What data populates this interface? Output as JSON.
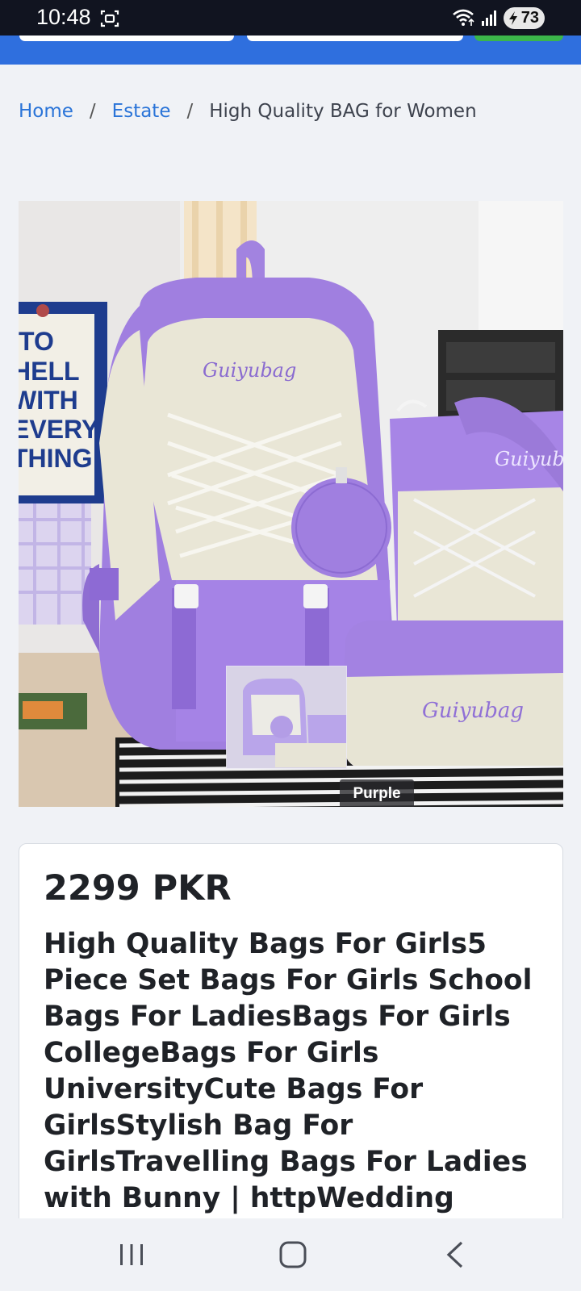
{
  "status_bar": {
    "time": "10:48",
    "battery": "73",
    "icons": [
      "screenshot-icon",
      "wifi-icon",
      "signal-icon",
      "battery-icon"
    ]
  },
  "breadcrumb": {
    "home": "Home",
    "category": "Estate",
    "current": "High Quality BAG for Women"
  },
  "product": {
    "image_text_backpack": "Guiyubag",
    "image_text_tote": "Guiyub",
    "image_text_pouch": "Guiyubag",
    "image_poster_lines": [
      "TO",
      "HELL",
      "WITH",
      "EVERY",
      "THING"
    ],
    "color_tag": "Purple",
    "price": "2299 PKR",
    "title": "High Quality Bags For Girls5 Piece Set Bags For Girls School Bags For LadiesBags For Girls CollegeBags For Girls UniversityCute Bags For GirlsStylish Bag For GirlsTravelling Bags For Ladies with Bunny | httpWedding"
  },
  "nav_bar": {
    "icons": [
      "recent-apps-icon",
      "home-icon",
      "back-icon"
    ]
  },
  "colors": {
    "brand_blue": "#2f6fde",
    "link_blue": "#2a74d8",
    "bag_purple": "#a07fe0",
    "bag_cream": "#e9e6d6"
  }
}
